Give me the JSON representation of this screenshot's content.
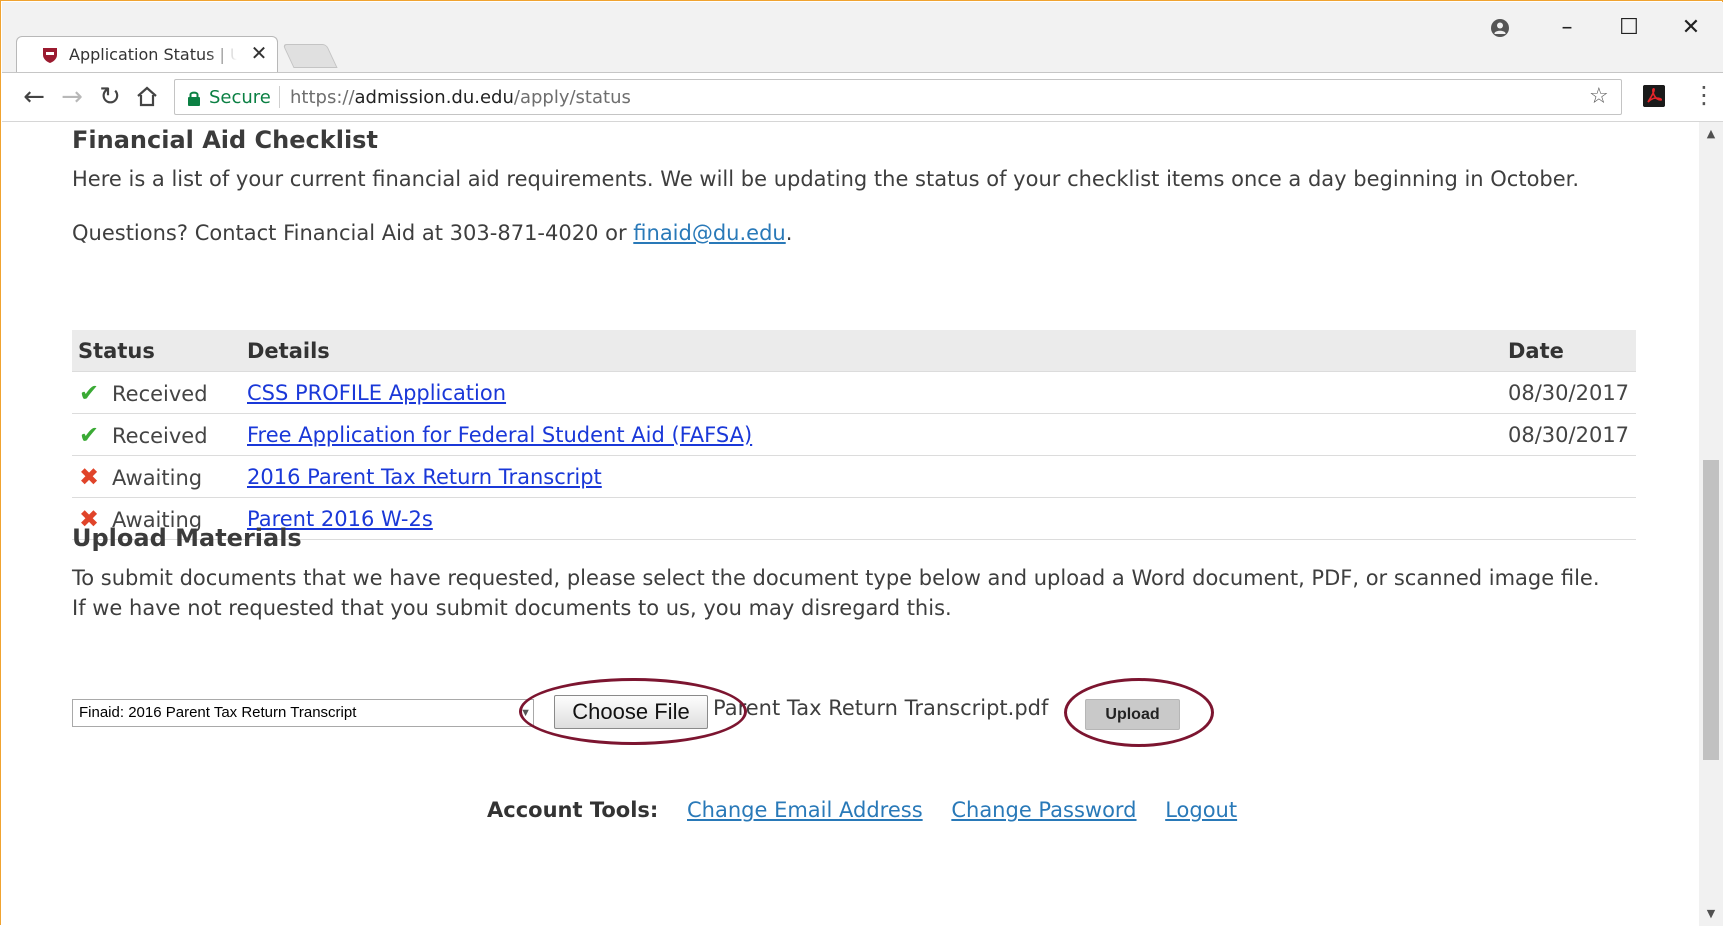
{
  "browser": {
    "tab_title": "Application Status | University of Denver",
    "secure_label": "Secure",
    "url_scheme": "https://",
    "url_host": "admission.du.edu",
    "url_path": "/apply/status",
    "icons": {
      "favicon": "du-shield-icon",
      "back": "back-arrow-icon",
      "forward": "forward-arrow-icon",
      "reload": "reload-icon",
      "home": "home-icon",
      "star": "bookmark-star-icon",
      "acrobat": "acrobat-extension-icon",
      "menu": "kebab-menu-icon",
      "profile": "profile-icon"
    }
  },
  "checklist": {
    "title": "Financial Aid Checklist",
    "intro": "Here is a list of your current financial aid requirements. We will be updating the status of your checklist items once a day beginning in October.",
    "questions_prefix": "Questions? Contact Financial Aid at 303-871-4020 or ",
    "questions_email": "finaid@du.edu",
    "questions_suffix": ".",
    "columns": {
      "status": "Status",
      "details": "Details",
      "date": "Date"
    },
    "rows": [
      {
        "status": "Received",
        "state": "received",
        "detail": "CSS PROFILE Application",
        "date": "08/30/2017"
      },
      {
        "status": "Received",
        "state": "received",
        "detail": "Free Application for Federal Student Aid (FAFSA)",
        "date": "08/30/2017"
      },
      {
        "status": "Awaiting",
        "state": "awaiting",
        "detail": "2016 Parent Tax Return Transcript",
        "date": ""
      },
      {
        "status": "Awaiting",
        "state": "awaiting",
        "detail": "Parent 2016 W-2s",
        "date": ""
      }
    ]
  },
  "upload": {
    "title": "Upload Materials",
    "instructions": "To submit documents that we have requested, please select the document type below and upload a Word document, PDF, or scanned image file. If we have not requested that you submit documents to us, you may disregard this.",
    "selected_document_type": "Finaid: 2016 Parent Tax Return Transcript",
    "choose_file_label": "Choose File",
    "chosen_file_name": "Parent Tax Return Transcript.pdf",
    "upload_label": "Upload",
    "highlight_color": "#7c1530"
  },
  "account_tools": {
    "label": "Account Tools:",
    "links": [
      "Change Email Address",
      "Change Password",
      "Logout"
    ]
  },
  "colors": {
    "link": "#2979b8",
    "table_link": "#1a38d8",
    "received_check": "#3aaa35",
    "awaiting_x": "#e0442a",
    "secure_green": "#0b8043"
  }
}
